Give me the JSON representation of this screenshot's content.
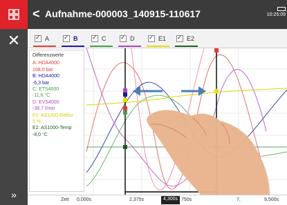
{
  "header": {
    "title": "Aufnahme-000003_140915-110617",
    "back_icon": "chevron-left-icon",
    "menu_icon": "grid-icon",
    "time": "10:25:09"
  },
  "sidebar": {
    "close_icon": "close-icon",
    "expand_icon": "double-chevron-right-icon"
  },
  "tabs": [
    {
      "label": "A",
      "color": "#e53935",
      "bold": false
    },
    {
      "label": "B",
      "color": "#1a1aa0",
      "bold": true
    },
    {
      "label": "C",
      "color": "#43a047",
      "bold": false
    },
    {
      "label": "D",
      "color": "#ab47bc",
      "bold": false
    },
    {
      "label": "E1",
      "color": "#e6e000",
      "bold": false
    },
    {
      "label": "E2",
      "color": "#1b5e20",
      "bold": false
    }
  ],
  "legend": {
    "title": "Differenzwerte",
    "entries": [
      {
        "name": "A: HDA4000",
        "value": "108,0 bar",
        "color": "#e53935"
      },
      {
        "name": "B: HDA4000",
        "value": "-6,3 bar",
        "color": "#1a1aa0"
      },
      {
        "name": "C: ETS4000",
        "value": "-11,6 °C",
        "color": "#43a047"
      },
      {
        "name": "D: EVS4000",
        "value": "-38,7 l/min",
        "color": "#ab47bc"
      },
      {
        "name": "E1: AS1000-Relitiv",
        "value": "5 %",
        "color": "#d8d000"
      },
      {
        "name": "E2: AS1000-Temp",
        "value": "-8,0 °C",
        "color": "#1b5e20"
      }
    ]
  },
  "timebar": {
    "label": "Zeit",
    "start": "0,000s",
    "t1": "2,375s",
    "cursor": "4,300s",
    "t2": "750s",
    "t3": "7,",
    "end": "9,500s"
  },
  "colors": {
    "accent": "#e0222b",
    "topbar": "#3b3b3b",
    "arrow": "#4a7fb5",
    "cursor_line": "#000000"
  }
}
